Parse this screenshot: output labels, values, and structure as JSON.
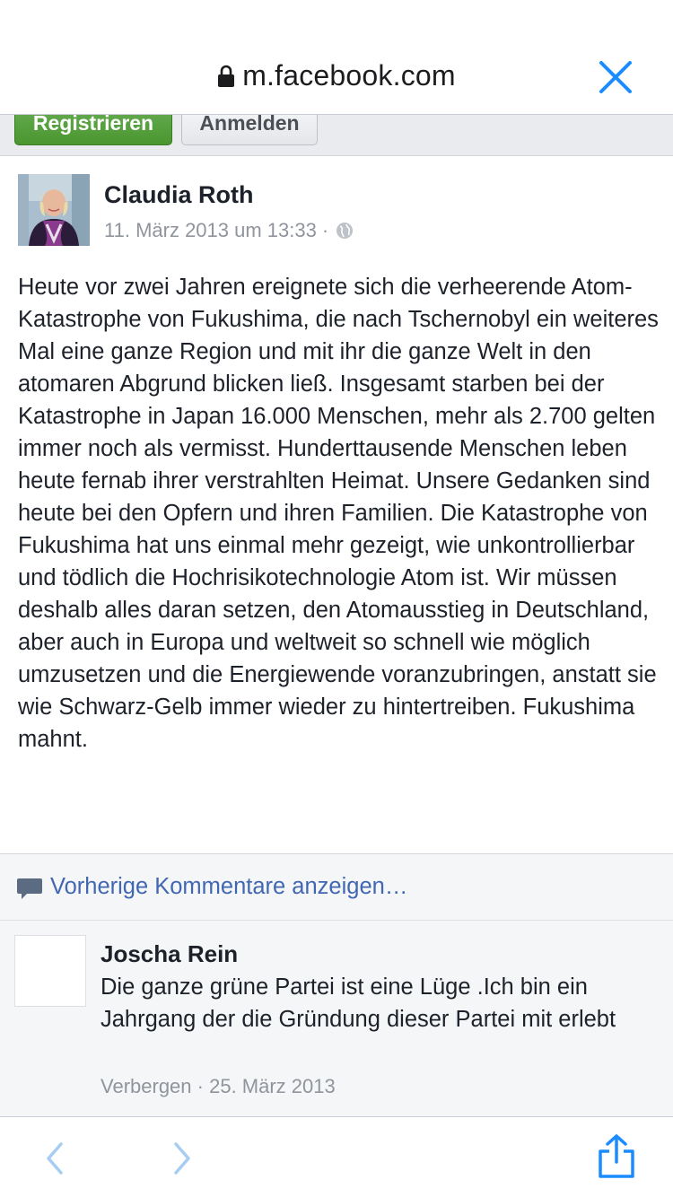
{
  "browser": {
    "url": "m.facebook.com",
    "lock_icon": "lock-icon",
    "close_icon": "close-icon",
    "accent": "#1a8cff"
  },
  "auth": {
    "register_label": "Registrieren",
    "login_label": "Anmelden",
    "register_color": "#4b962f"
  },
  "post": {
    "author": "Claudia Roth",
    "timestamp": "11. März 2013 um 13:33",
    "separator": "·",
    "privacy_icon": "globe-icon",
    "text": "Heute vor zwei Jahren ereignete sich die verheerende Atom-Katastrophe von Fukushima, die nach Tschernobyl ein weiteres Mal eine ganze Region und mit ihr die ganze Welt in den atomaren Abgrund blicken ließ. Insgesamt starben bei der Katastrophe in Japan 16.000 Menschen, mehr als 2.700 gelten immer noch als vermisst. Hunderttausende Menschen leben heute fernab ihrer verstrahlten Heimat. Unsere Gedanken sind heute bei den Opfern und ihren Familien. Die Katastrophe von Fukushima hat uns einmal mehr gezeigt, wie unkontrollierbar und tödlich die Hochrisikotechnologie Atom ist. Wir müssen deshalb alles daran setzen, den Atomausstieg in Deutschland, aber auch in Europa und weltweit so schnell wie möglich umzusetzen und die Energiewende voranzubringen, anstatt sie wie Schwarz-Gelb immer wieder zu hintertreiben. Fukushima mahnt."
  },
  "comments": {
    "previous_label": "Vorherige Kommentare anzeigen…",
    "items": [
      {
        "author": "Joscha Rein",
        "text": "Die ganze grüne Partei ist eine Lüge .Ich bin ein Jahrgang der die Gründung dieser Partei mit erlebt",
        "hide_label": "Verbergen",
        "separator": " · ",
        "date": "25. März 2013"
      }
    ]
  },
  "toolbar": {
    "back_icon": "chevron-left-icon",
    "forward_icon": "chevron-right-icon",
    "share_icon": "share-icon"
  }
}
